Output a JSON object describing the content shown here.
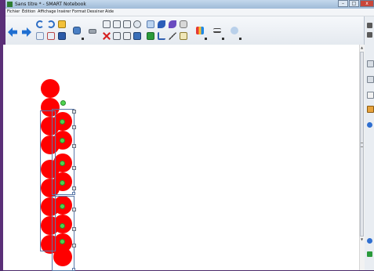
{
  "window": {
    "title": "Sans titre * - SMART Notebook",
    "controls": {
      "minimize": "–",
      "maximize": "□",
      "close": "x"
    }
  },
  "menubar": {
    "items": [
      "Fichier",
      "Édition",
      "Affichage",
      "Insérer",
      "Format",
      "Dessiner",
      "Aide"
    ]
  },
  "toolbar": {
    "icons": [
      "back-arrow-icon",
      "forward-arrow-icon",
      "undo-icon",
      "redo-icon",
      "add-page-icon",
      "delete-page-icon",
      "open-file-icon",
      "save-icon",
      "document-camera-icon",
      "keyboard-icon",
      "capture-icon",
      "table-icon",
      "measurement-tools-icon",
      "screen-shade-icon",
      "delete-icon",
      "full-screen-icon",
      "dual-page-icon",
      "select-icon",
      "pen-icon",
      "creative-pen-icon",
      "eraser-icon",
      "line-icon",
      "shape-icon",
      "fill-icon",
      "magic-pen-icon",
      "color-palette-icon",
      "line-style-icon",
      "transparency-icon"
    ]
  },
  "scrollbar": {
    "up": "▲",
    "down": "▼"
  },
  "colors": {
    "circle_fill": "#ff0000",
    "selection_border": "#5a78a8",
    "rotation_handle": "#4fd34f",
    "desktop": "#4a2a6a"
  }
}
